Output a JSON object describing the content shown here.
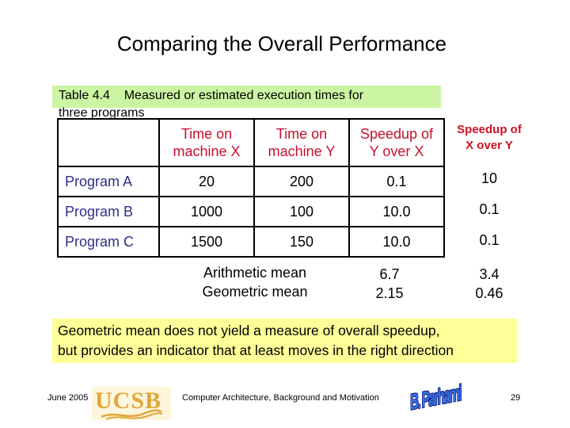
{
  "slide": {
    "title": "Comparing the Overall Performance"
  },
  "caption": {
    "line1": "Table 4.4    Measured or estimated execution times for",
    "line2": "three programs"
  },
  "table": {
    "headers": [
      "",
      "Time on machine X",
      "Time on machine Y",
      "Speedup of Y over X"
    ],
    "header_lines": [
      [
        "",
        ""
      ],
      [
        "Time on",
        "machine X"
      ],
      [
        "Time on",
        "machine Y"
      ],
      [
        "Speedup of",
        "Y over X"
      ]
    ],
    "rows": [
      {
        "program": "Program A",
        "time_x": "20",
        "time_y": "200",
        "speedup_y_over_x": "0.1"
      },
      {
        "program": "Program B",
        "time_x": "1000",
        "time_y": "100",
        "speedup_y_over_x": "10.0"
      },
      {
        "program": "Program C",
        "time_x": "1500",
        "time_y": "150",
        "speedup_y_over_x": "10.0"
      }
    ]
  },
  "extra_column": {
    "header_line1": "Speedup of",
    "header_line2": "X over Y",
    "values": [
      "10",
      "0.1",
      "0.1"
    ]
  },
  "means": {
    "arithmetic_label": "Arithmetic mean",
    "geometric_label": "Geometric mean",
    "y_over_x": {
      "arithmetic": "6.7",
      "geometric": "2.15"
    },
    "x_over_y": {
      "arithmetic": "3.4",
      "geometric": "0.46"
    }
  },
  "note": {
    "line1": "Geometric mean does not yield a measure of overall speedup,",
    "line2": "but provides an indicator that at least moves in the right direction"
  },
  "footer": {
    "date": "June 2005",
    "logo_text": "UCSB",
    "course": "Computer Architecture, Background and Motivation",
    "author_logo_text": "B. Parhami",
    "page_number": "29"
  },
  "colors": {
    "caption_bg": "#ccf5a3",
    "header_text": "#c8102e",
    "program_text": "#2e2e8a",
    "note_bg": "#ffff99",
    "ucsb_gold": "#e1a53a",
    "author_blue": "#3b6fe0"
  }
}
